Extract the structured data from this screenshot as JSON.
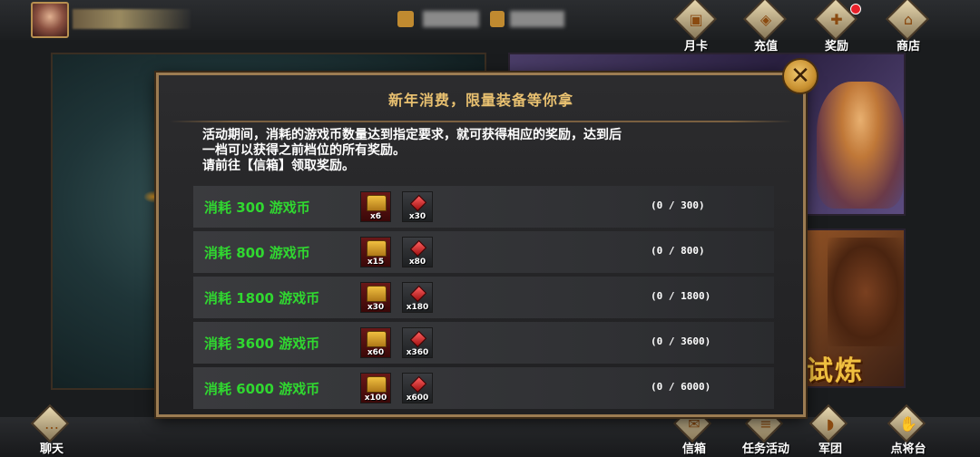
{
  "top_nav": [
    {
      "label": "月卡",
      "icon": "month-card-icon",
      "glyph": "▣"
    },
    {
      "label": "充值",
      "icon": "recharge-icon",
      "glyph": "◈"
    },
    {
      "label": "奖励",
      "icon": "gift-icon",
      "glyph": "✚",
      "badge": true
    },
    {
      "label": "商店",
      "icon": "shop-icon",
      "glyph": "⌂"
    }
  ],
  "bottom_nav": {
    "chat": "聊天",
    "mailbox": "信箱",
    "tasks": "任务活动",
    "legion": "军团",
    "general_stage": "点将台"
  },
  "background": {
    "trial_banner": "试炼"
  },
  "dialog": {
    "title": "新年消费，限量装备等你拿",
    "description_line1": "活动期间，消耗的游戏币数量达到指定要求，就可获得相应的奖励，达到后",
    "description_line2": "一档可以获得之前档位的所有奖励。",
    "description_line3": "请前往【信箱】领取奖励。",
    "close_glyph": "✕",
    "tiers": [
      {
        "cost": "消耗 300 游戏币",
        "chest_qty": "x6",
        "gem_qty": "x30",
        "progress": "(0 / 300)"
      },
      {
        "cost": "消耗 800 游戏币",
        "chest_qty": "x15",
        "gem_qty": "x80",
        "progress": "(0 / 800)"
      },
      {
        "cost": "消耗 1800 游戏币",
        "chest_qty": "x30",
        "gem_qty": "x180",
        "progress": "(0 / 1800)"
      },
      {
        "cost": "消耗 3600 游戏币",
        "chest_qty": "x60",
        "gem_qty": "x360",
        "progress": "(0 / 3600)"
      },
      {
        "cost": "消耗 6000 游戏币",
        "chest_qty": "x100",
        "gem_qty": "x600",
        "progress": "(0 / 6000)"
      }
    ]
  },
  "colors": {
    "title_gold": "#e8c070",
    "cost_green": "#30d830",
    "frame_bronze": "#9c7c52",
    "badge_red": "#e8202a"
  }
}
